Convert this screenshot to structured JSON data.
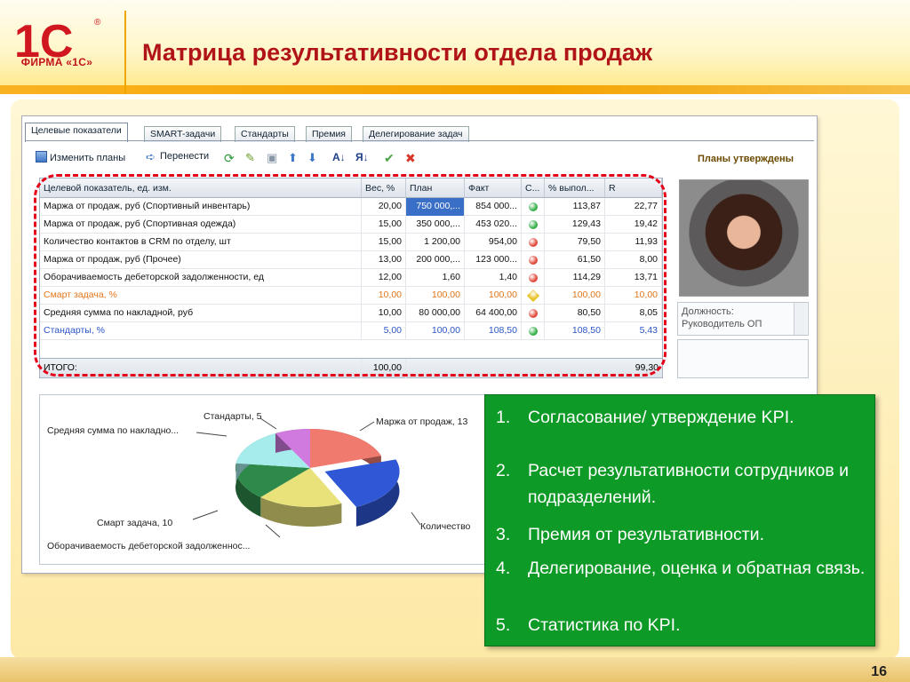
{
  "brand": {
    "logo_text": "1С",
    "logo_sub": "ФИРМА «1С»",
    "registered": "®"
  },
  "slide_title": "Матрица результативности отдела продаж",
  "page_number": "16",
  "tabs": [
    "Целевые показатели",
    "SMART-задачи",
    "Стандарты",
    "Премия",
    "Делегирование задач"
  ],
  "toolbar": {
    "change_plans": "Изменить планы",
    "move": "Перенести",
    "status": "Планы утверждены"
  },
  "grid": {
    "headers": [
      "Целевой показатель, ед. изм.",
      "Вес, %",
      "План",
      "Факт",
      "С...",
      "% выпол...",
      "R"
    ],
    "rows": [
      {
        "name": "Маржа от продаж, руб (Спортивный инвентарь)",
        "weight": "20,00",
        "plan": "750 000,...",
        "fact": "854 000...",
        "status": "green",
        "pct": "113,87",
        "r": "22,77",
        "style": "normal"
      },
      {
        "name": "Маржа от продаж, руб (Спортивная одежда)",
        "weight": "15,00",
        "plan": "350 000,...",
        "fact": "453 020...",
        "status": "green",
        "pct": "129,43",
        "r": "19,42",
        "style": "normal"
      },
      {
        "name": "Количество контактов в CRM по отделу, шт",
        "weight": "15,00",
        "plan": "1 200,00",
        "fact": "954,00",
        "status": "red",
        "pct": "79,50",
        "r": "11,93",
        "style": "normal"
      },
      {
        "name": "Маржа от продаж, руб (Прочее)",
        "weight": "13,00",
        "plan": "200 000,...",
        "fact": "123 000...",
        "status": "red",
        "pct": "61,50",
        "r": "8,00",
        "style": "normal"
      },
      {
        "name": "Оборачиваемость дебеторской задолженности, ед",
        "weight": "12,00",
        "plan": "1,60",
        "fact": "1,40",
        "status": "red",
        "pct": "114,29",
        "r": "13,71",
        "style": "normal"
      },
      {
        "name": "Смарт задача, %",
        "weight": "10,00",
        "plan": "100,00",
        "fact": "100,00",
        "status": "yellow",
        "pct": "100,00",
        "r": "10,00",
        "style": "orange"
      },
      {
        "name": "Средняя сумма по накладной, руб",
        "weight": "10,00",
        "plan": "80 000,00",
        "fact": "64 400,00",
        "status": "red",
        "pct": "80,50",
        "r": "8,05",
        "style": "normal"
      },
      {
        "name": "Стандарты, %",
        "weight": "5,00",
        "plan": "100,00",
        "fact": "108,50",
        "status": "green",
        "pct": "108,50",
        "r": "5,43",
        "style": "blue"
      }
    ],
    "total": {
      "label": "ИТОГО:",
      "weight": "100,00",
      "r": "99,30"
    }
  },
  "employee": {
    "position_label": "Должность:",
    "position_value": "Руководитель ОП"
  },
  "chart_data": {
    "type": "pie",
    "title": "",
    "slices": [
      {
        "label": "Маржа от продаж, 13",
        "value": 13,
        "color": "#f07a6e"
      },
      {
        "label": "Количество",
        "value": 15,
        "color": "#2f57d6"
      },
      {
        "label": "Оборачиваемость дебеторской задолженнос...",
        "value": 12,
        "color": "#e9e27a"
      },
      {
        "label": "Смарт задача, 10",
        "value": 10,
        "color": "#2e8a4a"
      },
      {
        "label": "Средняя сумма по накладно...",
        "value": 10,
        "color": "#a6ecec"
      },
      {
        "label": "Стандарты, 5",
        "value": 5,
        "color": "#d07ae0"
      }
    ]
  },
  "list": [
    {
      "n": "1.",
      "t": "Согласование/ утверждение KPI."
    },
    {
      "n": "2.",
      "t": "Расчет результативности сотрудников и подразделений."
    },
    {
      "n": "3.",
      "t": " Премия от результативности."
    },
    {
      "n": "4.",
      "t": "Делегирование, оценка и обратная связь."
    },
    {
      "n": "5.",
      "t": "Статистика по KPI."
    }
  ]
}
